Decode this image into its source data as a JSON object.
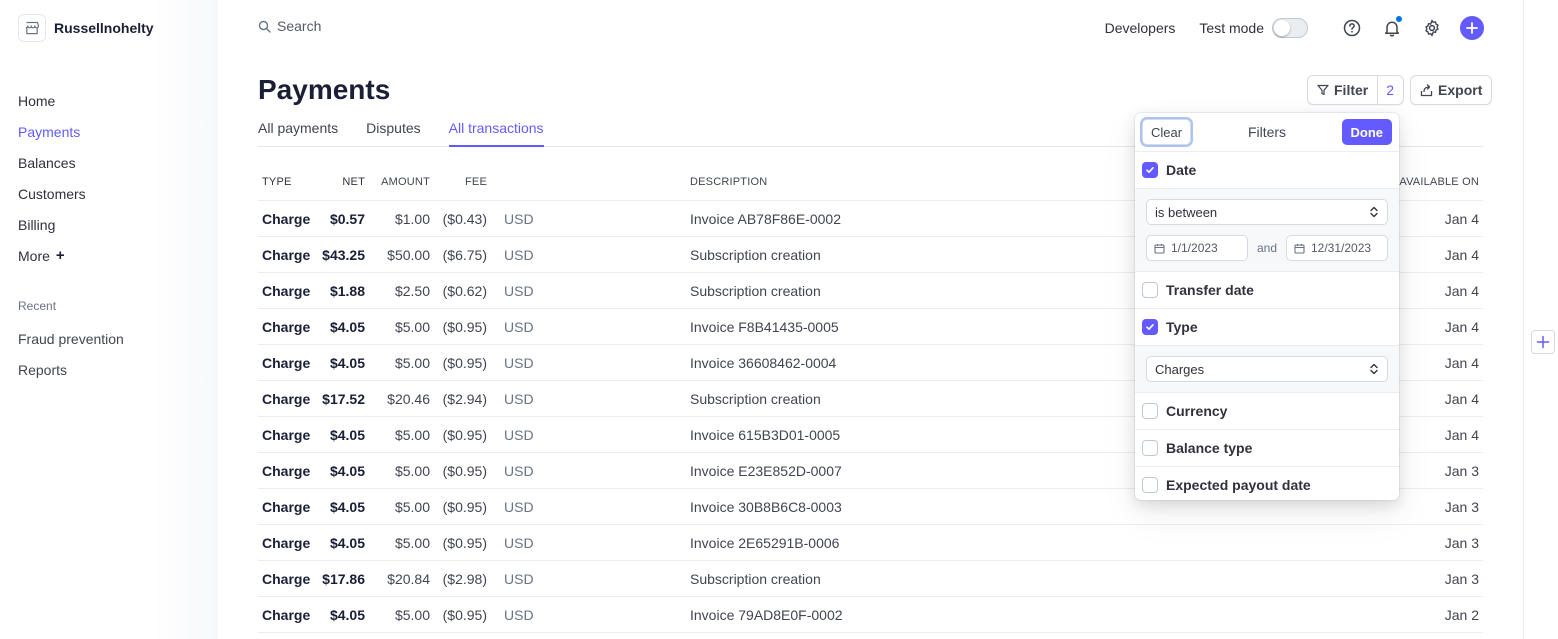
{
  "account": {
    "name": "Russellnohelty"
  },
  "sidebar": {
    "items": [
      {
        "label": "Home",
        "active": false
      },
      {
        "label": "Payments",
        "active": true
      },
      {
        "label": "Balances",
        "active": false
      },
      {
        "label": "Customers",
        "active": false
      },
      {
        "label": "Billing",
        "active": false
      },
      {
        "label": "More",
        "active": false
      }
    ],
    "recent_heading": "Recent",
    "recent": [
      "Fraud prevention",
      "Reports"
    ]
  },
  "topbar": {
    "search_label": "Search",
    "developers": "Developers",
    "test_mode": "Test mode",
    "test_mode_on": false
  },
  "page": {
    "title": "Payments",
    "tabs": [
      {
        "label": "All payments",
        "active": false
      },
      {
        "label": "Disputes",
        "active": false
      },
      {
        "label": "All transactions",
        "active": true
      }
    ],
    "filter_label": "Filter",
    "filter_count": "2",
    "export_label": "Export"
  },
  "table": {
    "headers": {
      "type": "TYPE",
      "net": "NET",
      "amount": "AMOUNT",
      "fee": "FEE",
      "description": "DESCRIPTION",
      "available_on": "AVAILABLE ON"
    },
    "rows": [
      {
        "type": "Charge",
        "net": "$0.57",
        "amount": "$1.00",
        "fee": "($0.43)",
        "currency": "USD",
        "description": "Invoice AB78F86E-0002",
        "available_on": "Jan 4"
      },
      {
        "type": "Charge",
        "net": "$43.25",
        "amount": "$50.00",
        "fee": "($6.75)",
        "currency": "USD",
        "description": "Subscription creation",
        "available_on": "Jan 4"
      },
      {
        "type": "Charge",
        "net": "$1.88",
        "amount": "$2.50",
        "fee": "($0.62)",
        "currency": "USD",
        "description": "Subscription creation",
        "available_on": "Jan 4"
      },
      {
        "type": "Charge",
        "net": "$4.05",
        "amount": "$5.00",
        "fee": "($0.95)",
        "currency": "USD",
        "description": "Invoice F8B41435-0005",
        "available_on": "Jan 4"
      },
      {
        "type": "Charge",
        "net": "$4.05",
        "amount": "$5.00",
        "fee": "($0.95)",
        "currency": "USD",
        "description": "Invoice 36608462-0004",
        "available_on": "Jan 4"
      },
      {
        "type": "Charge",
        "net": "$17.52",
        "amount": "$20.46",
        "fee": "($2.94)",
        "currency": "USD",
        "description": "Subscription creation",
        "available_on": "Jan 4"
      },
      {
        "type": "Charge",
        "net": "$4.05",
        "amount": "$5.00",
        "fee": "($0.95)",
        "currency": "USD",
        "description": "Invoice 615B3D01-0005",
        "available_on": "Jan 4"
      },
      {
        "type": "Charge",
        "net": "$4.05",
        "amount": "$5.00",
        "fee": "($0.95)",
        "currency": "USD",
        "description": "Invoice E23E852D-0007",
        "available_on": "Jan 3"
      },
      {
        "type": "Charge",
        "net": "$4.05",
        "amount": "$5.00",
        "fee": "($0.95)",
        "currency": "USD",
        "description": "Invoice 30B8B6C8-0003",
        "available_on": "Jan 3"
      },
      {
        "type": "Charge",
        "net": "$4.05",
        "amount": "$5.00",
        "fee": "($0.95)",
        "currency": "USD",
        "description": "Invoice 2E65291B-0006",
        "available_on": "Jan 3"
      },
      {
        "type": "Charge",
        "net": "$17.86",
        "amount": "$20.84",
        "fee": "($2.98)",
        "currency": "USD",
        "description": "Subscription creation",
        "available_on": "Jan 3"
      },
      {
        "type": "Charge",
        "net": "$4.05",
        "amount": "$5.00",
        "fee": "($0.95)",
        "currency": "USD",
        "description": "Invoice 79AD8E0F-0002",
        "available_on": "Jan 2"
      }
    ]
  },
  "filters": {
    "title": "Filters",
    "clear_label": "Clear",
    "done_label": "Done",
    "date": {
      "label": "Date",
      "checked": true,
      "operator": "is between",
      "start": "1/1/2023",
      "and_label": "and",
      "end": "12/31/2023"
    },
    "transfer_date": {
      "label": "Transfer date",
      "checked": false
    },
    "type": {
      "label": "Type",
      "checked": true,
      "value": "Charges"
    },
    "currency": {
      "label": "Currency",
      "checked": false
    },
    "balance_type": {
      "label": "Balance type",
      "checked": false
    },
    "expected_payout_date": {
      "label": "Expected payout date",
      "checked": false
    }
  },
  "colors": {
    "accent": "#635bff",
    "text": "#1a1f36",
    "notification_dot": "#0073e6"
  }
}
